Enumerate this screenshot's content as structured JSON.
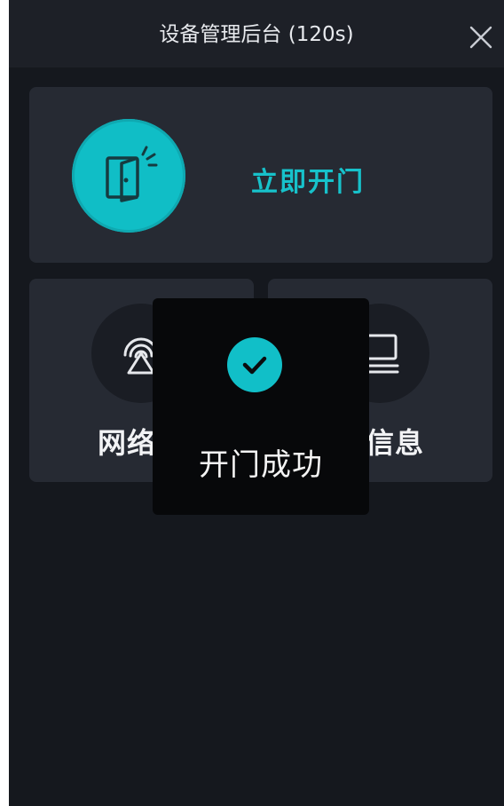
{
  "header": {
    "title": "设备管理后台 (120s)",
    "close_icon": "close-icon"
  },
  "open_door": {
    "label": "立即开门",
    "icon": "door-open-icon",
    "accent": "#10bec6"
  },
  "cards": [
    {
      "label": "网络配",
      "icon": "network-signal-icon"
    },
    {
      "label": "备信息",
      "icon": "device-info-icon"
    }
  ],
  "toast": {
    "message": "开门成功",
    "icon": "check-circle-icon"
  },
  "colors": {
    "background": "#15181e",
    "card": "#262a33",
    "header": "#1d2027",
    "toast": "#07080a"
  }
}
